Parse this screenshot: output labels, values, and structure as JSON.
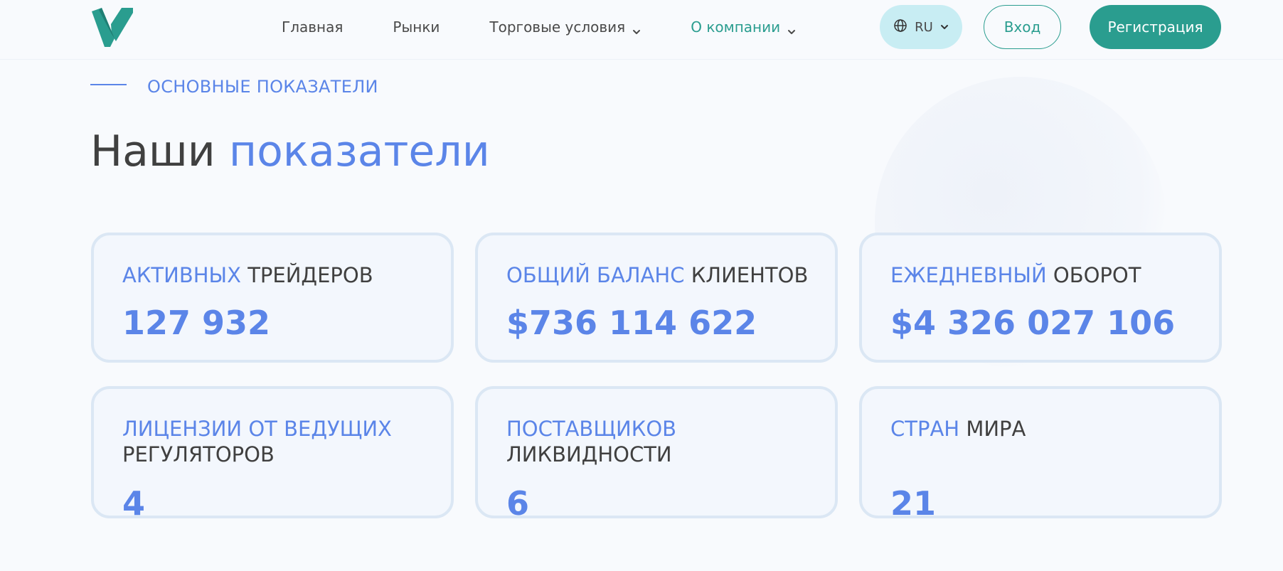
{
  "header": {
    "nav": [
      {
        "label": "Главная",
        "has_dropdown": false
      },
      {
        "label": "Рынки",
        "has_dropdown": false
      },
      {
        "label": "Торговые условия",
        "has_dropdown": true
      },
      {
        "label": "О компании",
        "has_dropdown": true,
        "active": true
      }
    ],
    "language": "RU",
    "login_label": "Вход",
    "signup_label": "Регистрация"
  },
  "section": {
    "eyebrow": "ОСНОВНЫЕ ПОКАЗАТЕЛИ",
    "title_plain": "Наши ",
    "title_accent": "показатели"
  },
  "stats": [
    {
      "label_highlight": "АКТИВНЫХ",
      "label_rest": " ТРЕЙДЕРОВ",
      "value": "127 932"
    },
    {
      "label_highlight": "ОБЩИЙ БАЛАНС",
      "label_rest": " КЛИЕНТОВ",
      "value": "$736 114 622"
    },
    {
      "label_highlight": "ЕЖЕДНЕВНЫЙ",
      "label_rest": " ОБОРОТ",
      "value": "$4 326 027 106"
    },
    {
      "label_highlight": "ЛИЦЕНЗИИ ОТ ВЕДУЩИХ",
      "label_rest": " РЕГУЛЯТОРОВ",
      "value": "4"
    },
    {
      "label_highlight": "ПОСТАВЩИКОВ",
      "label_rest": " ЛИКВИДНОСТИ",
      "value": "6"
    },
    {
      "label_highlight": "СТРАН",
      "label_rest": " МИРА",
      "value": "21"
    }
  ],
  "colors": {
    "brand_green": "#2a9d8f",
    "accent_blue": "#5b85e8",
    "text_dark": "#404040",
    "card_border": "#dbe7f4",
    "lang_bg": "#c8edf3"
  },
  "icons": {
    "logo": "v-logo-icon",
    "language": "globe-icon",
    "dropdown": "chevron-down-icon"
  }
}
